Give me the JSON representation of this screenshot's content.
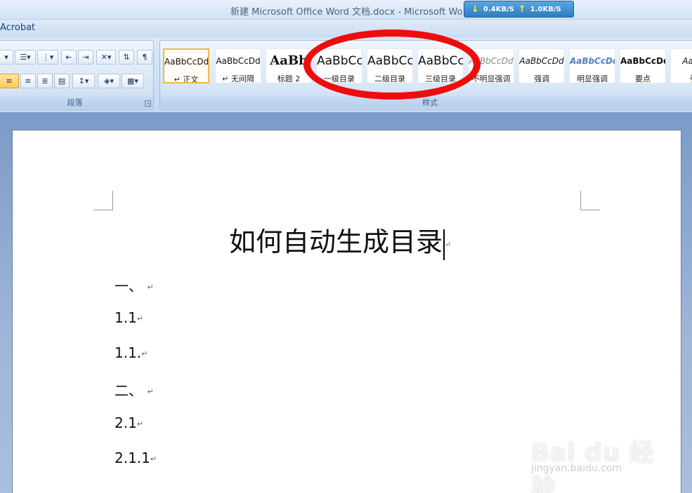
{
  "window": {
    "title": "新建 Microsoft Office Word 文档.docx - Microsoft Wo"
  },
  "net_speed": {
    "down": "0.4KB/S",
    "up": "1.0KB/S"
  },
  "tabs": {
    "acrobat": "Acrobat"
  },
  "ribbon": {
    "paragraph_group_label": "段落",
    "styles_group_label": "样式",
    "styles": [
      {
        "sample": "AaBbCcDd",
        "name": "↵ 正文"
      },
      {
        "sample": "AaBbCcDd",
        "name": "↵ 无间隔"
      },
      {
        "sample": "AaBb",
        "name": "标题 2"
      },
      {
        "sample": "AaBbCc",
        "name": "一级目录"
      },
      {
        "sample": "AaBbCc",
        "name": "二级目录"
      },
      {
        "sample": "AaBbCc",
        "name": "三级目录"
      },
      {
        "sample": "AaBbCcDd",
        "name": "不明显强调"
      },
      {
        "sample": "AaBbCcDd",
        "name": "强调"
      },
      {
        "sample": "AaBbCcDd",
        "name": "明显强调"
      },
      {
        "sample": "AaBbCcDd",
        "name": "要点"
      },
      {
        "sample": "AaBb",
        "name": "引"
      }
    ],
    "selected_style_index": 0
  },
  "document": {
    "title": "如何自动生成目录",
    "lines": [
      "一、",
      "1.1",
      "1.1.",
      "二、",
      "2.1",
      "2.1.1"
    ],
    "paragraph_mark": "↵"
  },
  "watermark": {
    "brand": "Bai du 经验",
    "url": "jingyan.baidu.com"
  },
  "colors": {
    "annotation_ring": "#ee0d0d",
    "selected_style_border": "#f1b74a"
  }
}
